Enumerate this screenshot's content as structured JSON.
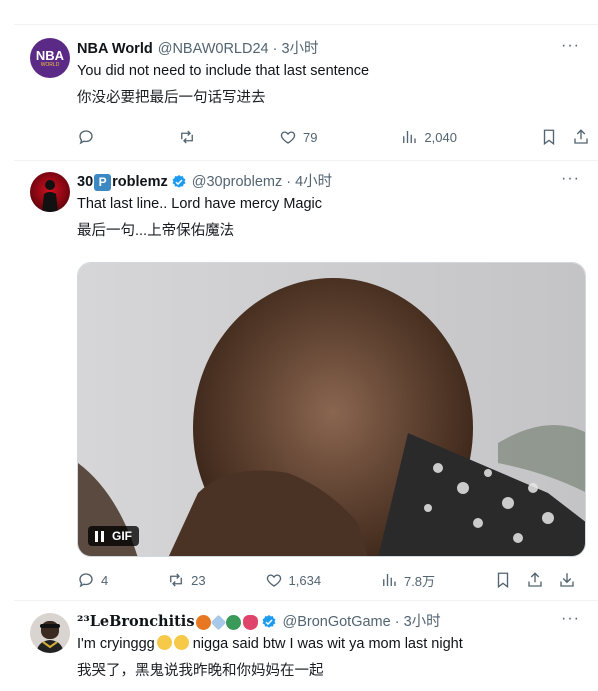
{
  "tweets": [
    {
      "name": "NBA World",
      "handle": "@NBAW0RLD24 · 3小时",
      "text": "You did not need to include that last sentence",
      "translation": "你没必要把最后一句话写进去",
      "avatar_text": "NBA",
      "avatar_subtext": "WORLD",
      "stats": {
        "likes": "79",
        "views": "2,040",
        "replies": "",
        "retweets": ""
      }
    },
    {
      "name_prefix": "30",
      "name_badge": "P",
      "name_suffix": "roblemz",
      "handle": "@30problemz · 4小时",
      "text": "That last line.. Lord have mercy Magic",
      "translation": "最后一句...上帝保佑魔法",
      "media_badge": "GIF",
      "stats": {
        "replies": "4",
        "retweets": "23",
        "likes": "1,634",
        "views": "7.8万"
      }
    },
    {
      "name": "²³LeBronchitis",
      "handle": "@BronGotGame · 3小时",
      "text_before": "I'm cryinggg",
      "text_after": " nigga said btw I was wit ya mom last night",
      "translation": "我哭了，黑鬼说我昨晚和你妈妈在一起"
    }
  ],
  "icons": [
    "reply-icon",
    "retweet-icon",
    "like-icon",
    "views-icon",
    "bookmark-icon",
    "share-icon",
    "download-icon",
    "more-icon",
    "verified-icon"
  ],
  "colors": {
    "verified": "#1d9bf0",
    "muted": "#536471",
    "divider": "#eff3f4"
  }
}
